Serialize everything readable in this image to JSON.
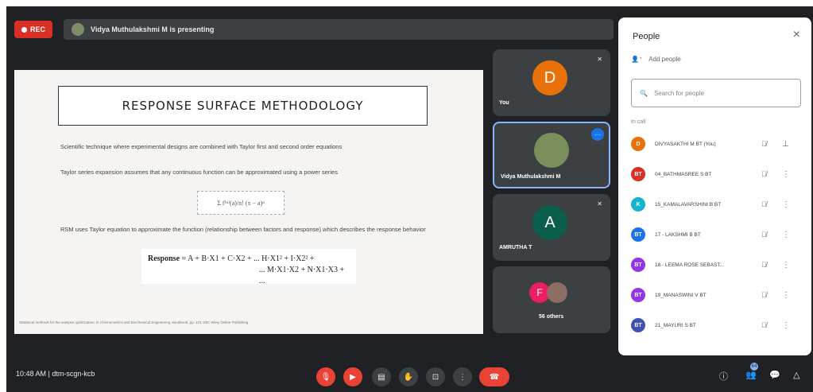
{
  "rec_label": "REC",
  "presenting_text": "Vidya Muthulakshmi M is presenting",
  "slide": {
    "title": "RESPONSE SURFACE METHODOLOGY",
    "para1": "Scientific technique where experimental designs are combined with Taylor first and second order equations",
    "para2": "Taylor series expansion assumes that any continuous function can be approximated using a power series",
    "formula": "Σ f⁽ⁿ⁾(a)/n! (x − a)ⁿ",
    "para3": "RSM uses Taylor equation to approximate the function (relationship between factors and response) which describes the response behavior",
    "response_label": "Response",
    "response_line1": "= A + B·X1 + C·X2 + ... H·X1² + I·X2² +",
    "response_line2": "... M·X1·X2 + N·X1·X3 + ...",
    "footnote": "Statistical methods for the analysis optimization; in Chemometrics and Biochemical Engineering Handbook; pp. 101-108; Wiley Online Publishing"
  },
  "tiles": {
    "you": {
      "initial": "D",
      "name": "You"
    },
    "presenter": {
      "name": "Vidya Muthulakshmi M"
    },
    "amrutha": {
      "initial": "A",
      "name": "AMRUTHA T"
    },
    "others": {
      "initial": "F",
      "name": "56 others"
    }
  },
  "people": {
    "title": "People",
    "add_people": "Add people",
    "search_placeholder": "Search for people",
    "section": "In call",
    "rows": [
      {
        "initial": "D",
        "name": "DIVYASAKTHI M BT (You)",
        "color": "#e8710a"
      },
      {
        "initial": "BT",
        "name": "04_BATHMASREE S BT",
        "color": "#d93025"
      },
      {
        "initial": "K",
        "name": "15_KAMALAVARSHINI B BT",
        "color": "#12b5cb"
      },
      {
        "initial": "BT",
        "name": "17 - LAKSHMI B BT",
        "color": "#1a73e8"
      },
      {
        "initial": "BT",
        "name": "18 - LEEMA ROSE SEBAST...",
        "color": "#9334e6"
      },
      {
        "initial": "BT",
        "name": "19_MANASWINI V BT",
        "color": "#9334e6"
      },
      {
        "initial": "BT",
        "name": "21_MAYURI S BT",
        "color": "#3f51b5"
      }
    ]
  },
  "bottom": {
    "time_meeting": "10:48 AM  |  dtm-scgn-kcb",
    "participant_count": "64"
  }
}
